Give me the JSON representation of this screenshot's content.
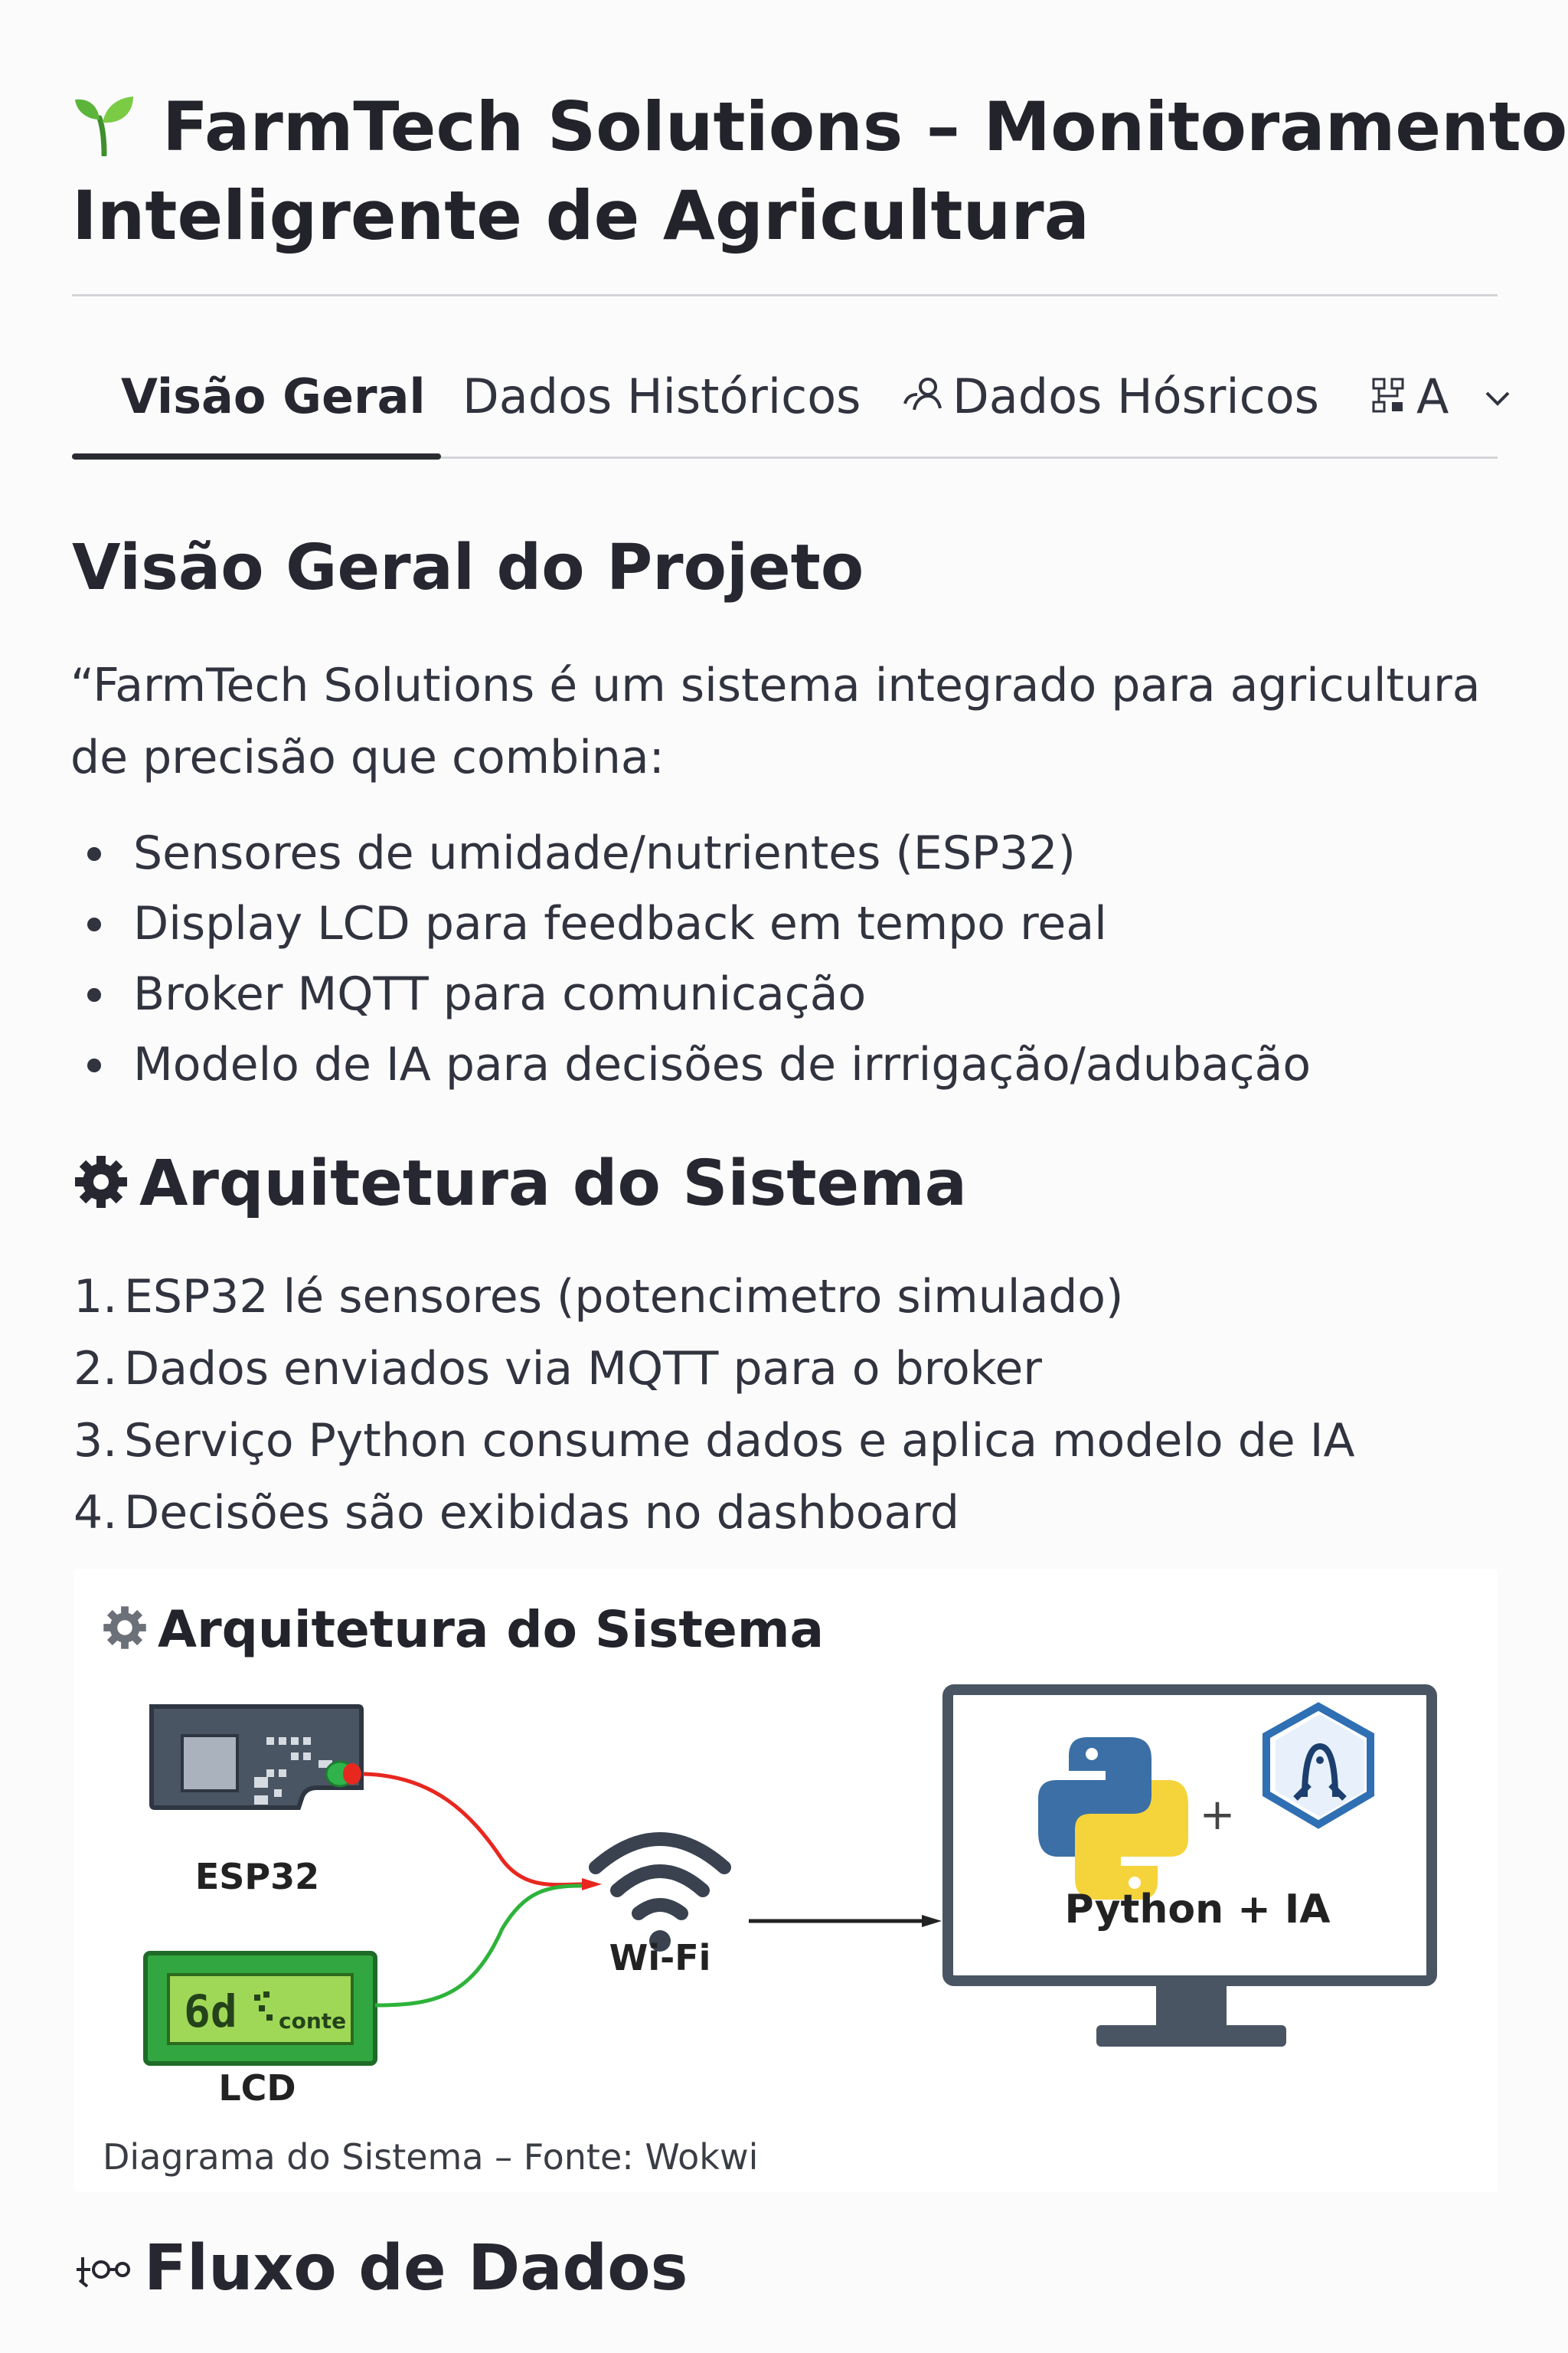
{
  "header": {
    "title_line1": "FarmTech Solutions – Monitoramento",
    "title_line2": "Inteligrente de Agricultura",
    "title_icon": "seedling-icon"
  },
  "tabs": [
    {
      "label": "Visão Geral",
      "active": true
    },
    {
      "label": "Dados Históricos",
      "active": false
    },
    {
      "label": "Dados Hósricos",
      "active": false,
      "icon": "people-icon"
    },
    {
      "label": "A",
      "active": false,
      "icon": "network-icon"
    }
  ],
  "overview": {
    "heading": "Visão Geral do Projeto",
    "intro": "“FarmTech Solutions é um sistema integrado para agricultura de precisão que combina:",
    "bullets": [
      "Sensores de umidade/nutrientes (ESP32)",
      "Display LCD para feedback em tempo real",
      "Broker MQTT para comunicação",
      "Modelo de IA para decisões de irrrigação/adubação"
    ]
  },
  "architecture": {
    "heading": "Arquitetura do Sistema",
    "steps": [
      "ESP32 lé sensores (potencimetro simulado)",
      "Dados enviados via MQTT para o broker",
      "Serviço Python consume dados e aplica  modelo de IA",
      "Decisões são exibidas no dashboard"
    ]
  },
  "diagram": {
    "title": "Arquitetura do Sistema",
    "esp32_label": "ESP32",
    "lcd_label": "LCD",
    "lcd_screen_text": "6d",
    "lcd_screen_small": "conte",
    "wifi_label": "Wi-Fi",
    "monitor_label": "Python + IA",
    "plus": "+",
    "caption": "Diagrama do Sistema – Fonte: Wokwi"
  },
  "dataflow": {
    "heading": "Fluxo de Dados"
  },
  "colors": {
    "text": "#262730",
    "accent_wire_red": "#e8271f",
    "accent_wire_green": "#2db33a",
    "lcd_green": "#8fd14f",
    "python_blue": "#3b6fa6",
    "python_yellow": "#f5d33b"
  }
}
